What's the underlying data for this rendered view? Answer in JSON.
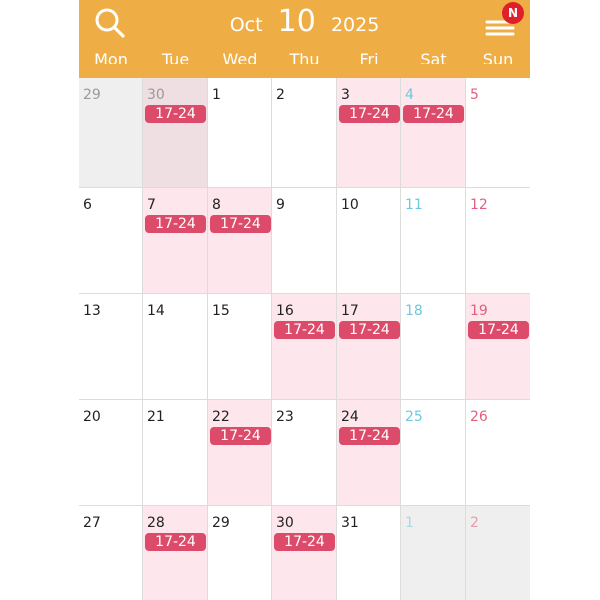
{
  "header": {
    "month": "Oct",
    "day": "10",
    "year": "2025",
    "notification_badge": "N",
    "icons": {
      "search": "search-icon",
      "menu": "menu-icon"
    },
    "colors": {
      "header": "#eeae45",
      "shift_label": "#dd4b6a",
      "shift_cell": "#fde7ed",
      "saturday": "#6ec8df",
      "sunday": "#e2607e",
      "badge": "#e11f2a"
    }
  },
  "weekdays": [
    "Mon",
    "Tue",
    "Wed",
    "Thu",
    "Fri",
    "Sat",
    "Sun"
  ],
  "weeks": [
    [
      {
        "day": "29",
        "other": true,
        "shift": ""
      },
      {
        "day": "30",
        "other": true,
        "shift": "17-24"
      },
      {
        "day": "1",
        "other": false,
        "shift": ""
      },
      {
        "day": "2",
        "other": false,
        "shift": ""
      },
      {
        "day": "3",
        "other": false,
        "shift": "17-24"
      },
      {
        "day": "4",
        "other": false,
        "shift": "17-24"
      },
      {
        "day": "5",
        "other": false,
        "shift": ""
      }
    ],
    [
      {
        "day": "6",
        "other": false,
        "shift": ""
      },
      {
        "day": "7",
        "other": false,
        "shift": "17-24"
      },
      {
        "day": "8",
        "other": false,
        "shift": "17-24"
      },
      {
        "day": "9",
        "other": false,
        "shift": ""
      },
      {
        "day": "10",
        "other": false,
        "shift": ""
      },
      {
        "day": "11",
        "other": false,
        "shift": ""
      },
      {
        "day": "12",
        "other": false,
        "shift": ""
      }
    ],
    [
      {
        "day": "13",
        "other": false,
        "shift": ""
      },
      {
        "day": "14",
        "other": false,
        "shift": ""
      },
      {
        "day": "15",
        "other": false,
        "shift": ""
      },
      {
        "day": "16",
        "other": false,
        "shift": "17-24"
      },
      {
        "day": "17",
        "other": false,
        "shift": "17-24"
      },
      {
        "day": "18",
        "other": false,
        "shift": ""
      },
      {
        "day": "19",
        "other": false,
        "shift": "17-24"
      }
    ],
    [
      {
        "day": "20",
        "other": false,
        "shift": ""
      },
      {
        "day": "21",
        "other": false,
        "shift": ""
      },
      {
        "day": "22",
        "other": false,
        "shift": "17-24"
      },
      {
        "day": "23",
        "other": false,
        "shift": ""
      },
      {
        "day": "24",
        "other": false,
        "shift": "17-24"
      },
      {
        "day": "25",
        "other": false,
        "shift": ""
      },
      {
        "day": "26",
        "other": false,
        "shift": ""
      }
    ],
    [
      {
        "day": "27",
        "other": false,
        "shift": ""
      },
      {
        "day": "28",
        "other": false,
        "shift": "17-24"
      },
      {
        "day": "29",
        "other": false,
        "shift": ""
      },
      {
        "day": "30",
        "other": false,
        "shift": "17-24"
      },
      {
        "day": "31",
        "other": false,
        "shift": ""
      },
      {
        "day": "1",
        "other": true,
        "shift": ""
      },
      {
        "day": "2",
        "other": true,
        "shift": ""
      }
    ]
  ]
}
